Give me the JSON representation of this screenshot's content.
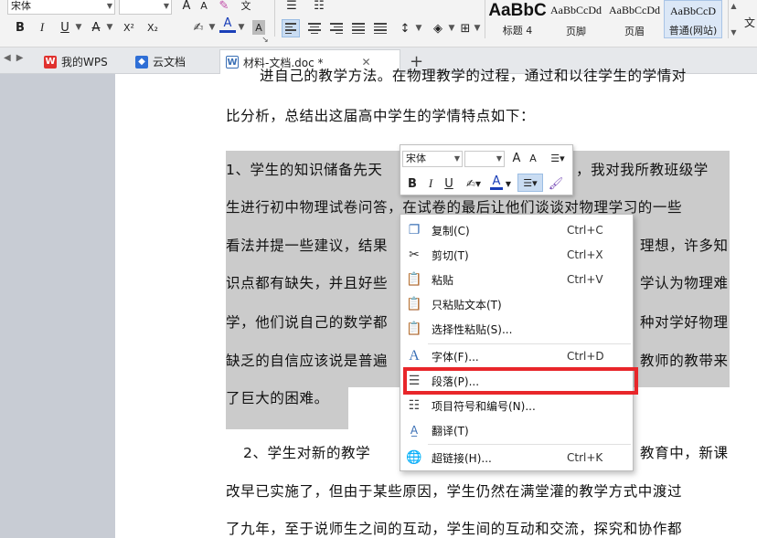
{
  "ribbon": {
    "font_name": "宋体",
    "font_size": "",
    "grow_font": "A",
    "shrink_font": "A",
    "bold": "B",
    "italic": "I",
    "underline": "U",
    "superscript": "X²",
    "subscript": "X₂",
    "font_color": "A",
    "styles": [
      {
        "preview": "AaBbC",
        "name": "标题 4"
      },
      {
        "preview": "AaBbCcDd",
        "name": "页脚"
      },
      {
        "preview": "AaBbCcDd",
        "name": "页眉"
      },
      {
        "preview": "AaBbCcD",
        "name": "普通(网站)"
      }
    ]
  },
  "tabs": [
    {
      "label": "我的WPS",
      "icon": "wps-logo-icon"
    },
    {
      "label": "云文档",
      "icon": "cloud-cube-icon"
    },
    {
      "label": "材料-文档.doc *",
      "icon": "doc-file-icon"
    }
  ],
  "document": {
    "lines": [
      "进自己的教学方法。在物理教学的过程，通过和以往学生的学情对",
      "比分析，总结出这届高中学生的学情特点如下：",
      "1、学生的知识储备先天",
      "，我对我所教班级学",
      "生进行初中物理试卷问答，在试卷的最后让他们谈谈对物理学习的一些",
      "看法并提一些建议，结果",
      "理想，许多知",
      "识点都有缺失，并且好些",
      "学认为物理难",
      "学，他们说自己的数学都",
      "种对学好物理",
      "缺乏的自信应该说是普遍",
      "教师的教带来",
      "了巨大的困难。",
      "2、学生对新的教学",
      "教育中，新课",
      "改早已实施了，但由于某些原因，学生仍然在满堂灌的教学方式中渡过",
      "了九年，至于说师生之间的互动，学生间的互动和交流，探究和协作都"
    ]
  },
  "minibar": {
    "font_name": "宋体",
    "font_size": "",
    "grow": "A",
    "shrink": "A",
    "bold": "B",
    "italic": "I",
    "underline": "U",
    "font_color": "A"
  },
  "context_menu": {
    "items": [
      {
        "label": "复制(C)",
        "shortcut": "Ctrl+C",
        "icon": "copy-icon"
      },
      {
        "label": "剪切(T)",
        "shortcut": "Ctrl+X",
        "icon": "scissors-icon"
      },
      {
        "label": "粘贴",
        "shortcut": "Ctrl+V",
        "icon": "paste-icon"
      },
      {
        "label": "只粘贴文本(T)",
        "shortcut": "",
        "icon": "paste-text-icon"
      },
      {
        "label": "选择性粘贴(S)...",
        "shortcut": "",
        "icon": "paste-special-icon"
      },
      {
        "label": "字体(F)...",
        "shortcut": "Ctrl+D",
        "icon": "font-icon"
      },
      {
        "label": "段落(P)...",
        "shortcut": "",
        "icon": "paragraph-icon"
      },
      {
        "label": "项目符号和编号(N)...",
        "shortcut": "",
        "icon": "bullets-icon"
      },
      {
        "label": "翻译(T)",
        "shortcut": "",
        "icon": "translate-icon"
      },
      {
        "label": "超链接(H)...",
        "shortcut": "Ctrl+K",
        "icon": "hyperlink-icon"
      }
    ]
  },
  "colors": {
    "highlight_box": "#e8262a",
    "selection": "#cbcbcb",
    "accent": "#3a6fb5"
  }
}
